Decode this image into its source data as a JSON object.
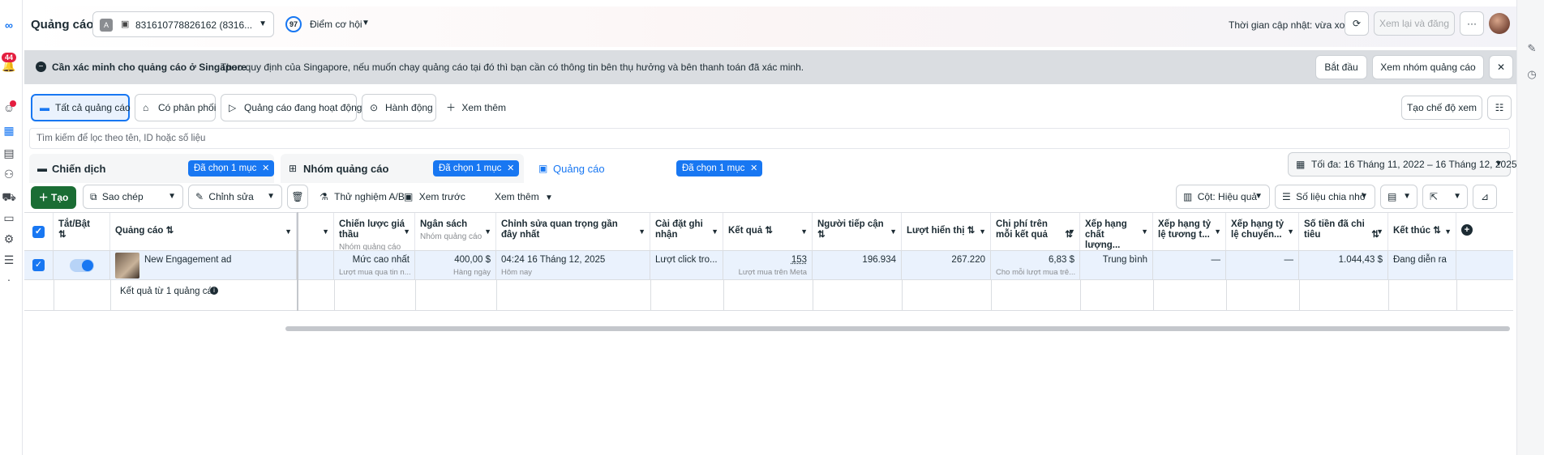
{
  "app": {
    "title": "Quảng cáo",
    "account_letter": "A",
    "account_name": "831610778826162 (8316...",
    "score": "97",
    "score_label": "Điểm cơ hội",
    "update_time": "Thời gian cập nhật: vừa xong",
    "review_publish": "Xem lại và đăng",
    "more": "···"
  },
  "left_rail": {
    "notification_count": "44"
  },
  "banner": {
    "title": "Cần xác minh cho quảng cáo ở Singapore",
    "text": "Theo quy định của Singapore, nếu muốn chạy quảng cáo tại đó thì bạn cần có thông tin bên thụ hưởng và bên thanh toán đã xác minh.",
    "start": "Bắt đầu",
    "view_adsets": "Xem nhóm quảng cáo",
    "close": "✕"
  },
  "filters": {
    "all_ads": "Tất cả quảng cáo",
    "delivered": "Có phân phối",
    "active_ads": "Quảng cáo đang hoạt động",
    "actions": "Hành động",
    "see_more": "Xem thêm",
    "create_view": "Tạo chế độ xem"
  },
  "search": {
    "placeholder": "Tìm kiếm để lọc theo tên, ID hoặc số liệu"
  },
  "level_tabs": {
    "campaign": "Chiến dịch",
    "adset": "Nhóm quảng cáo",
    "ad": "Quảng cáo",
    "chip": "Đã chọn 1 mục"
  },
  "date_range": "Tối đa: 16 Tháng 11, 2022 – 16 Tháng 12, 2025",
  "toolbar": {
    "create": "Tạo",
    "duplicate": "Sao chép",
    "edit": "Chỉnh sửa",
    "ab_test": "Thử nghiệm A/B",
    "preview": "Xem trước",
    "more": "Xem thêm",
    "columns": "Cột: Hiệu quả",
    "breakdown": "Số liệu chia nhỏ"
  },
  "table": {
    "headers": {
      "toggle": "Tắt/Bật",
      "ad": "Quảng cáo",
      "bid_strategy": "Chiến lược giá thầu",
      "bid_strategy_sub": "Nhóm quảng cáo",
      "budget": "Ngân sách",
      "budget_sub": "Nhóm quảng cáo",
      "last_edit": "Chỉnh sửa quan trọng gần đây nhất",
      "attribution": "Cài đặt ghi nhận",
      "results": "Kết quả",
      "reach": "Người tiếp cận",
      "impressions": "Lượt hiển thị",
      "cpr": "Chi phí trên mỗi kết quả",
      "quality": "Xếp hạng chất lượng...",
      "engagement_rank": "Xếp hạng tỷ lệ tương t...",
      "conversion_rank": "Xếp hạng tỷ lệ chuyển...",
      "spent": "Số tiền đã chi tiêu",
      "end": "Kết thúc"
    },
    "row": {
      "ad_name": "New Engagement ad",
      "bid_strategy": "Mức cao nhất",
      "bid_strategy_sub": "Lượt mua qua tin n...",
      "budget": "400,00 $",
      "budget_sub": "Hàng ngày",
      "last_edit": "04:24 16 Tháng 12, 2025",
      "last_edit_sub": "Hôm nay",
      "attribution": "Lượt click tro...",
      "results": "153",
      "results_sub": "Lượt mua trên Meta",
      "reach": "196.934",
      "impressions": "267.220",
      "cpr": "6,83 $",
      "cpr_sub": "Cho mỗi lượt mua trê...",
      "quality": "Trung bình",
      "engagement_rank": "—",
      "conversion_rank": "—",
      "spent": "1.044,43 $",
      "end": "Đang diễn ra"
    },
    "summary": "Kết quả từ 1 quảng cáo"
  }
}
